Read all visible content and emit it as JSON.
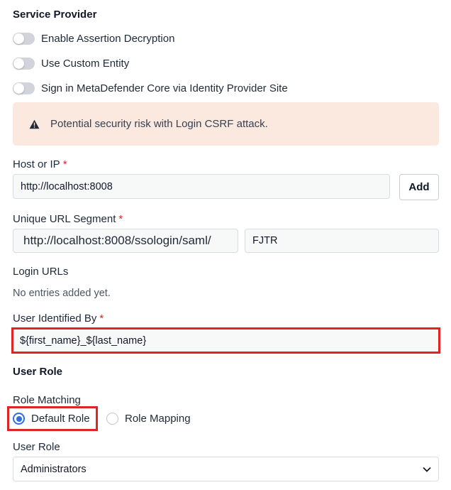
{
  "service_provider": {
    "title": "Service Provider",
    "toggles": [
      {
        "label": "Enable Assertion Decryption",
        "on": false
      },
      {
        "label": "Use Custom Entity",
        "on": false
      },
      {
        "label": "Sign in MetaDefender Core via Identity Provider Site",
        "on": false
      }
    ],
    "alert": {
      "icon": "warning-icon",
      "text": "Potential security risk with Login CSRF attack."
    }
  },
  "host": {
    "label": "Host or IP",
    "required_mark": "*",
    "value": "http://localhost:8008",
    "add_label": "Add"
  },
  "url_segment": {
    "label": "Unique URL Segment",
    "required_mark": "*",
    "prefix": "http://localhost:8008/ssologin/saml/",
    "value": "FJTR"
  },
  "login_urls": {
    "label": "Login URLs",
    "empty_text": "No entries added yet."
  },
  "user_identified": {
    "label": "User Identified By",
    "required_mark": "*",
    "value": "${first_name}_${last_name}"
  },
  "user_role_section": {
    "title": "User Role",
    "role_matching_label": "Role Matching",
    "options": [
      {
        "label": "Default Role",
        "selected": true
      },
      {
        "label": "Role Mapping",
        "selected": false
      }
    ],
    "user_role_label": "User Role",
    "selected_role": "Administrators"
  },
  "colors": {
    "highlight": "#e02424",
    "radio_accent": "#2f6fe0",
    "alert_background": "#fbe9e0",
    "required": "#dc2626"
  }
}
